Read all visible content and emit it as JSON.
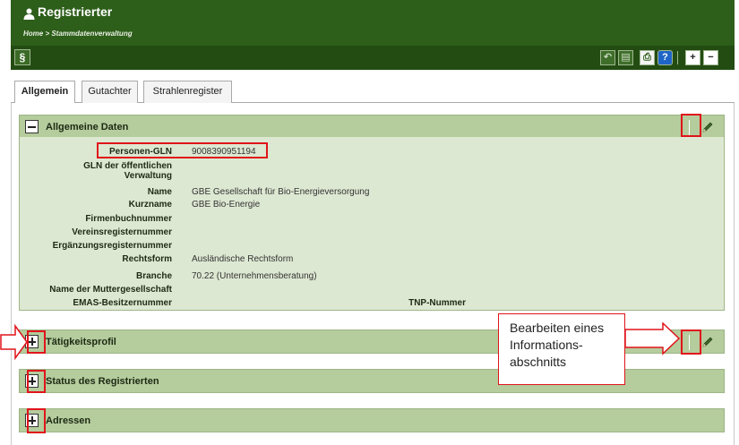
{
  "header": {
    "title": "Registrierter",
    "breadcrumb": "Home > Stammdatenverwaltung"
  },
  "toolbar": {
    "left_button": "§",
    "buttons": [
      {
        "name": "back-icon",
        "glyph": "↶"
      },
      {
        "name": "document-icon",
        "glyph": "▤"
      },
      {
        "name": "print-icon",
        "glyph": "⎙"
      },
      {
        "name": "help-icon",
        "glyph": "?"
      },
      {
        "name": "expand-all-icon",
        "glyph": "+"
      },
      {
        "name": "collapse-all-icon",
        "glyph": "−"
      }
    ]
  },
  "tabs": [
    {
      "label": "Allgemein",
      "active": true
    },
    {
      "label": "Gutachter",
      "active": false
    },
    {
      "label": "Strahlenregister",
      "active": false
    }
  ],
  "sections": {
    "general": {
      "title": "Allgemeine Daten",
      "expanded": true
    },
    "activity": {
      "title": "Tätigkeitsprofil",
      "expanded": false
    },
    "status": {
      "title": "Status des Registrierten",
      "expanded": false
    },
    "addresses": {
      "title": "Adressen",
      "expanded": false
    }
  },
  "general_fields": [
    {
      "label": "Personen-GLN",
      "value": "9008390951194"
    },
    {
      "label": "GLN der öffentlichen Verwaltung",
      "value": ""
    },
    {
      "label": "Name",
      "value": "GBE Gesellschaft für Bio-Energieversorgung"
    },
    {
      "label": "Kurzname",
      "value": "GBE Bio-Energie"
    },
    {
      "label": "Firmenbuchnummer",
      "value": ""
    },
    {
      "label": "Vereinsregisternummer",
      "value": ""
    },
    {
      "label": "Ergänzungsregisternummer",
      "value": ""
    },
    {
      "label": "Rechtsform",
      "value": "Ausländische Rechtsform"
    },
    {
      "label": "Branche",
      "value": "70.22 (Unternehmensberatung)"
    },
    {
      "label": "Name der Muttergesellschaft",
      "value": ""
    },
    {
      "label": "EMAS-Besitzernummer",
      "value": ""
    }
  ],
  "tnp_label": "TNP-Nummer",
  "callout_text": "Bearbeiten eines Informations-abschnitts",
  "colors": {
    "header_bg": "#2d5e1a",
    "toolbar_bg": "#234c12",
    "section_head_bg": "#b5cc9d",
    "section_body_bg": "#dde8d2",
    "annotation_red": "#e0141b"
  }
}
